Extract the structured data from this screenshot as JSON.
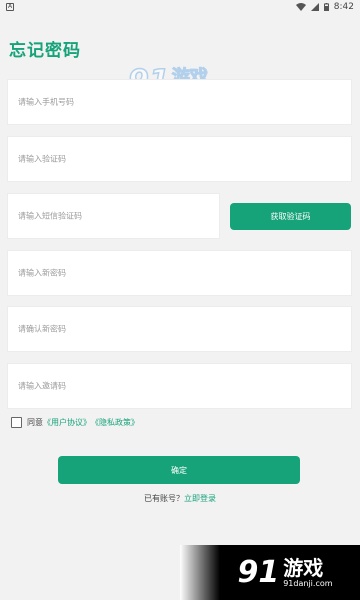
{
  "status_bar": {
    "app_icon": "A",
    "time": "8:42",
    "icons": [
      "wifi-icon",
      "signal-icon",
      "battery-icon"
    ]
  },
  "page": {
    "title": "忘记密码"
  },
  "watermark": {
    "number": "91",
    "brand": "游戏",
    "url": "91danji.com"
  },
  "form": {
    "phone_placeholder": "请输入手机号码",
    "captcha_placeholder": "请输入验证码",
    "sms_code_placeholder": "请输入短信验证码",
    "get_code_button": "获取验证码",
    "new_password_placeholder": "请输入新密码",
    "confirm_password_placeholder": "请确认新密码",
    "invite_code_placeholder": "请输入邀请码"
  },
  "agreement": {
    "prefix": "同意",
    "user_agreement": "《用户协议》",
    "privacy_policy": "《隐私政策》",
    "checked": false
  },
  "actions": {
    "confirm_button": "确定",
    "have_account": "已有账号？",
    "login_link": "立即登录"
  },
  "colors": {
    "accent": "#17a37a",
    "background": "#f2f2f2",
    "field_background": "#ffffff",
    "placeholder": "#9a9a9a"
  }
}
